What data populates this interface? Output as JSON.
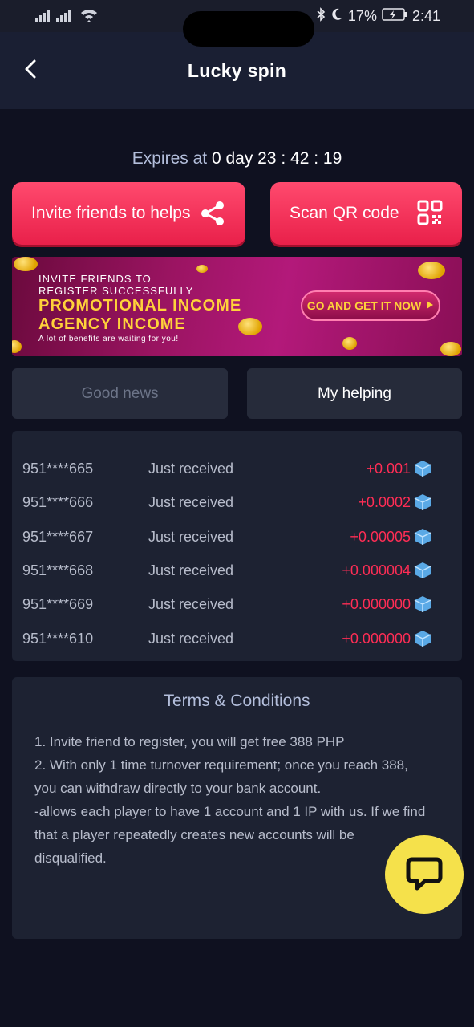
{
  "statusbar": {
    "battery_percent": "17%",
    "time": "2:41"
  },
  "header": {
    "title": "Lucky spin"
  },
  "expires": {
    "label": "Expires at",
    "countdown": "0 day 23 : 42 : 19"
  },
  "actions": {
    "invite_label": "Invite friends to helps",
    "scan_label": "Scan QR code"
  },
  "banner": {
    "line1": "INVITE FRIENDS TO",
    "line2": "REGISTER SUCCESSFULLY",
    "headline1": "PROMOTIONAL INCOME",
    "headline2": "AGENCY INCOME",
    "tagline": "A lot of benefits are waiting for you!",
    "cta": "GO AND GET IT NOW"
  },
  "tabs": [
    {
      "label": "Good news",
      "active": false
    },
    {
      "label": "My helping",
      "active": true
    }
  ],
  "records": [
    {
      "phone": "951****665",
      "status": "Just received",
      "amount": "+0.001"
    },
    {
      "phone": "951****666",
      "status": "Just received",
      "amount": "+0.0002"
    },
    {
      "phone": "951****667",
      "status": "Just received",
      "amount": "+0.00005"
    },
    {
      "phone": "951****668",
      "status": "Just received",
      "amount": "+0.000004"
    },
    {
      "phone": "951****669",
      "status": "Just received",
      "amount": "+0.000000"
    },
    {
      "phone": "951****610",
      "status": "Just received",
      "amount": "+0.000000"
    }
  ],
  "terms": {
    "title": "Terms & Conditions",
    "lines": [
      "1. Invite friend to register, you will get free 388 PHP",
      "2. With only 1 time turnover requirement; once you reach 388, you can withdraw directly to your bank account.",
      "-allows each player to have 1 account and 1 IP with us. If we find that a player repeatedly creates new accounts will be disqualified."
    ]
  },
  "colors": {
    "accent": "#e9204a",
    "amount": "#ff2d55",
    "chat_button": "#f5e14b",
    "background": "#0f1120"
  },
  "icons": {
    "back": "chevron-left-icon",
    "share": "share-icon",
    "qr": "qr-code-icon",
    "gem": "gem-icon",
    "chat": "chat-bubble-icon"
  }
}
